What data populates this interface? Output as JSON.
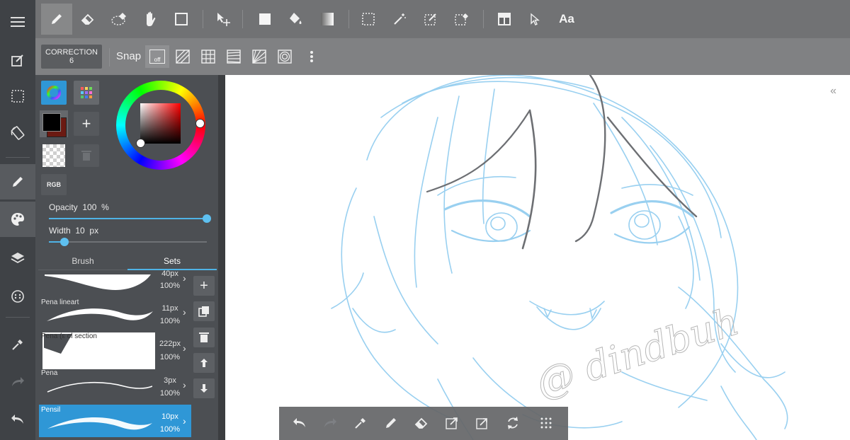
{
  "subbar": {
    "correction_label": "CORRECTION",
    "correction_value": "6",
    "snap_label": "Snap",
    "snap_off_label": "off"
  },
  "topbar": {
    "text_tool_label": "Aa"
  },
  "color": {
    "mode_label": "RGB",
    "foreground": "#000000",
    "background": "#6b1a12",
    "accent": "#4fb3e6"
  },
  "sliders": {
    "opacity_label": "Opacity",
    "opacity_value": "100",
    "opacity_unit": "%",
    "opacity_fraction": 1.0,
    "width_label": "Width",
    "width_value": "10",
    "width_unit": "px",
    "width_fraction": 0.1
  },
  "tabs": {
    "brush": "Brush",
    "sets": "Sets",
    "active": "Sets"
  },
  "brushes": [
    {
      "name": "",
      "size": "40px",
      "opacity": "100%"
    },
    {
      "name": "Pena lineart",
      "size": "11px",
      "opacity": "100%"
    },
    {
      "name": "Pena (ε ol section",
      "size": "222px",
      "opacity": "100%"
    },
    {
      "name": "Pena",
      "size": "3px",
      "opacity": "100%"
    },
    {
      "name": "Pensil",
      "size": "10px",
      "opacity": "100%"
    }
  ],
  "canvas": {
    "watermark": "@ dindbuh"
  }
}
